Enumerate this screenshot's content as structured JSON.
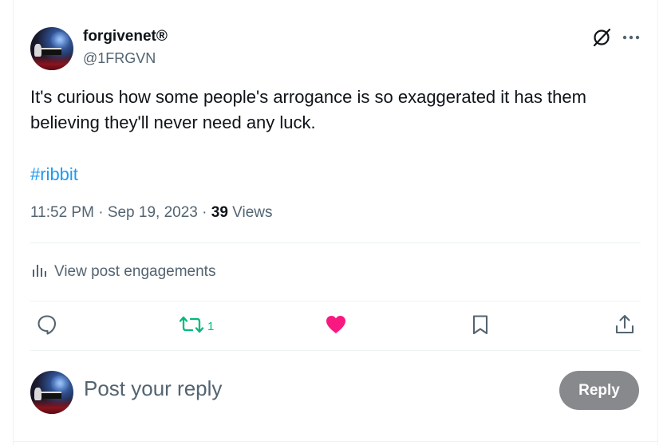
{
  "tweet": {
    "author": {
      "display_name": "forgivenet®",
      "handle": "@1FRGVN"
    },
    "text": "It's curious how some people's arrogance is so exaggerated it has them believing they'll never need any luck.",
    "hashtag": "#ribbit",
    "time": "11:52 PM",
    "date": "Sep 19, 2023",
    "separator": "·",
    "views_count": "39",
    "views_label": "Views"
  },
  "engagements": {
    "label": "View post engagements"
  },
  "actions": {
    "retweet_count": "1"
  },
  "reply": {
    "placeholder": "Post your reply",
    "button_label": "Reply"
  },
  "icons": {
    "grok": "grok-icon",
    "more": "more-horizontal-icon",
    "analytics": "analytics-bars-icon",
    "reply": "comment-bubble-icon",
    "retweet": "retweet-icon",
    "like": "heart-icon",
    "bookmark": "bookmark-icon",
    "share": "share-upload-icon"
  },
  "colors": {
    "link": "#1d9bf0",
    "retweet_active": "#00ba7c",
    "like_active": "#f91880",
    "secondary_text": "#536471",
    "reply_button_disabled": "#87898c"
  }
}
